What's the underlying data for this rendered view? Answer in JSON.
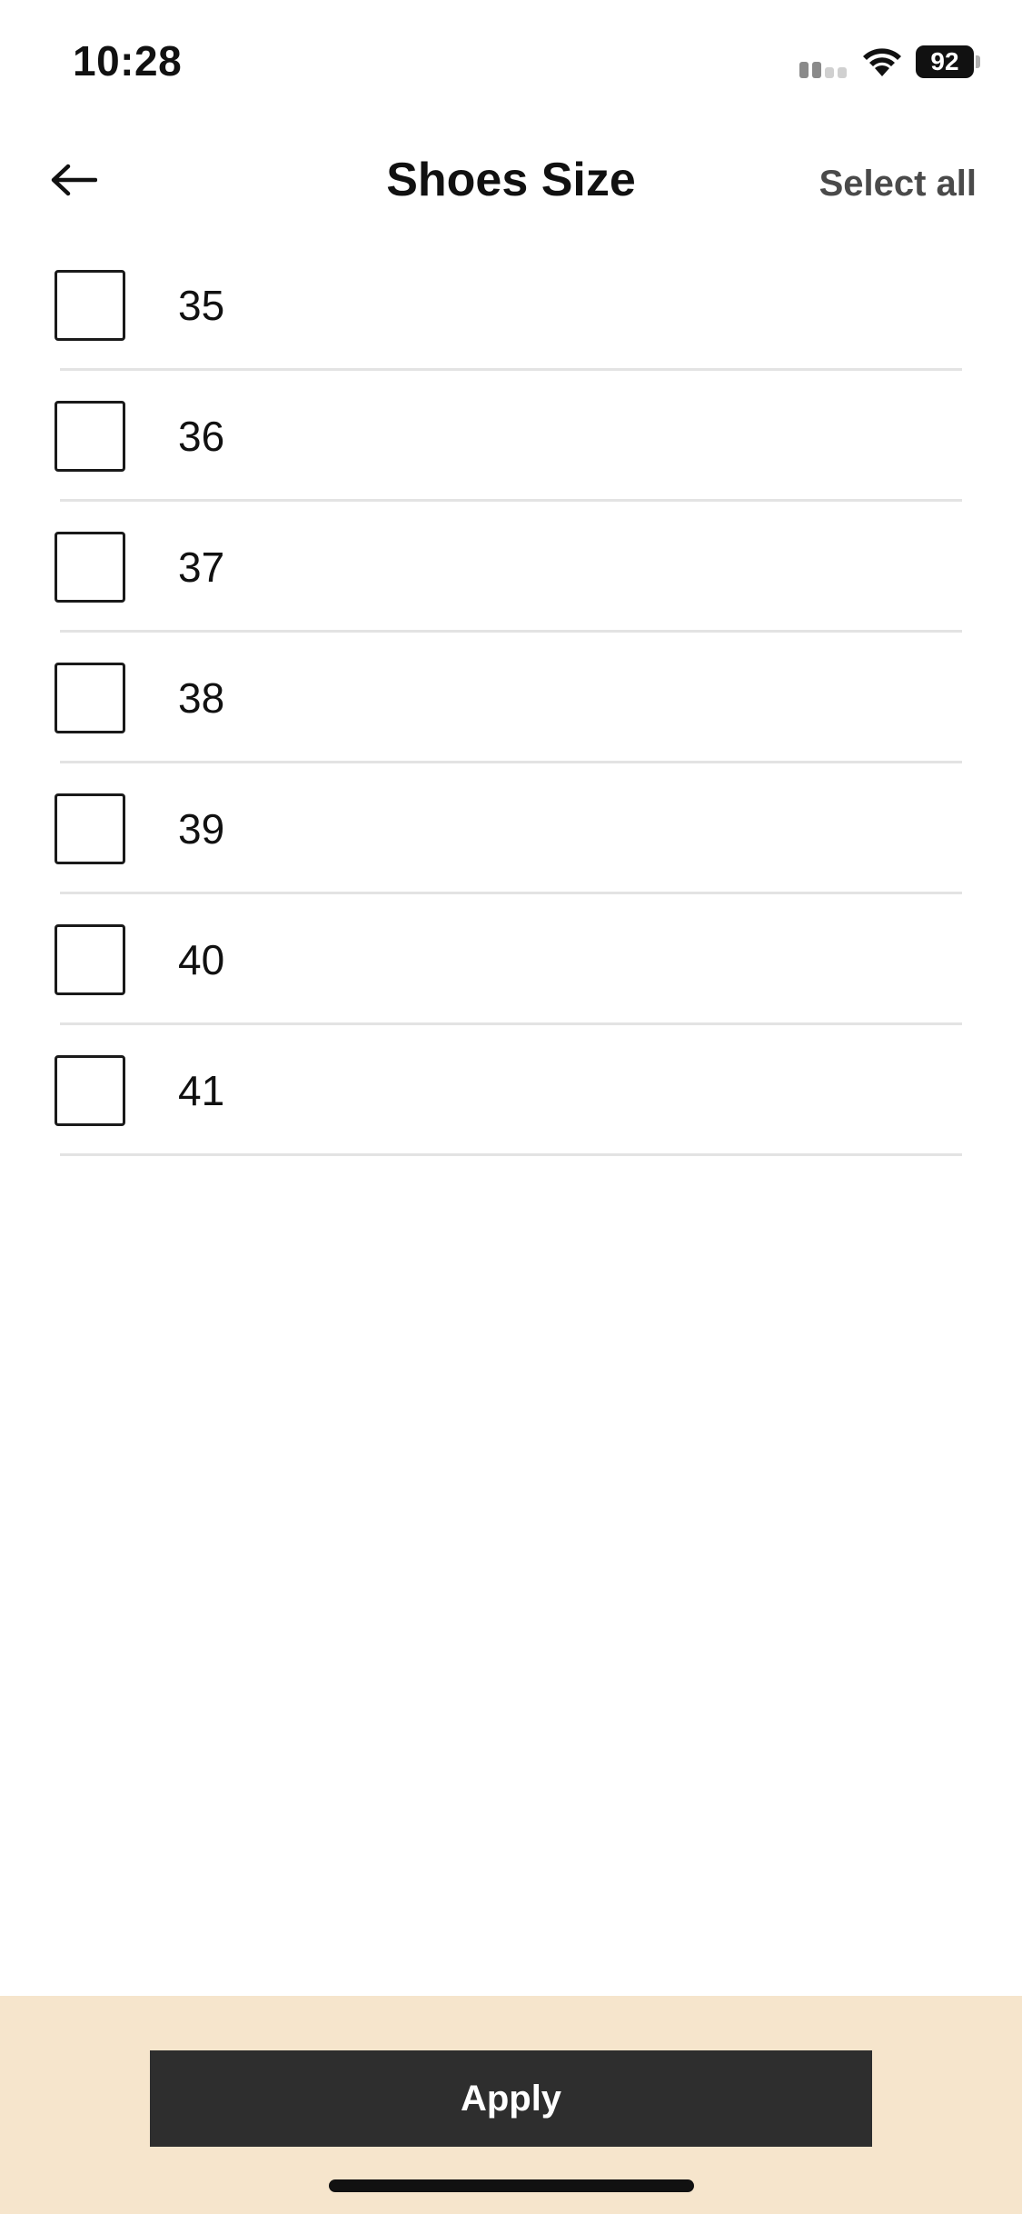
{
  "status_bar": {
    "time": "10:28",
    "battery": "92",
    "icons": [
      "signal-icon",
      "wifi-icon",
      "battery-icon"
    ]
  },
  "header": {
    "back_icon": "arrow-left-icon",
    "title": "Shoes Size",
    "select_all": "Select all"
  },
  "sizes": [
    {
      "label": "35",
      "checked": false
    },
    {
      "label": "36",
      "checked": false
    },
    {
      "label": "37",
      "checked": false
    },
    {
      "label": "38",
      "checked": false
    },
    {
      "label": "39",
      "checked": false
    },
    {
      "label": "40",
      "checked": false
    },
    {
      "label": "41",
      "checked": false
    }
  ],
  "footer": {
    "apply_label": "Apply"
  },
  "colors": {
    "footer_background": "#f6e5cc",
    "apply_button": "#2e2e2e",
    "divider": "#e3e3e3"
  }
}
